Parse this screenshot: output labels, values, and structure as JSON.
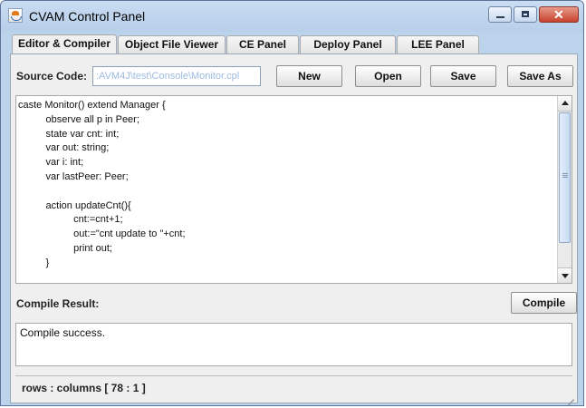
{
  "window": {
    "title": "CVAM Control Panel",
    "title_bg": "#bcd3ec"
  },
  "tabs": [
    {
      "label": "Editor & Compiler",
      "active": true
    },
    {
      "label": "Object File Viewer"
    },
    {
      "label": "CE Panel"
    },
    {
      "label": "Deploy Panel"
    },
    {
      "label": "LEE Panel"
    }
  ],
  "toolbar": {
    "source_label": "Source Code:",
    "source_path": ":AVM4J\\test\\Console\\Monitor.cpl",
    "new_label": "New",
    "open_label": "Open",
    "save_label": "Save",
    "save_as_label": "Save As"
  },
  "editor": {
    "lines": [
      "caste Monitor() extend Manager {",
      "          observe all p in Peer;",
      "          state var cnt: int;",
      "          var out: string;",
      "          var i: int;",
      "          var lastPeer: Peer;",
      "",
      "          action updateCnt(){",
      "                    cnt:=cnt+1;",
      "                    out:=\"cnt update to \"+cnt;",
      "                    print out;",
      "          }"
    ]
  },
  "compile": {
    "result_label": "Compile Result:",
    "button_label": "Compile",
    "output": "Compile success."
  },
  "status": {
    "text": "rows : columns [ 78 : 1 ]"
  }
}
